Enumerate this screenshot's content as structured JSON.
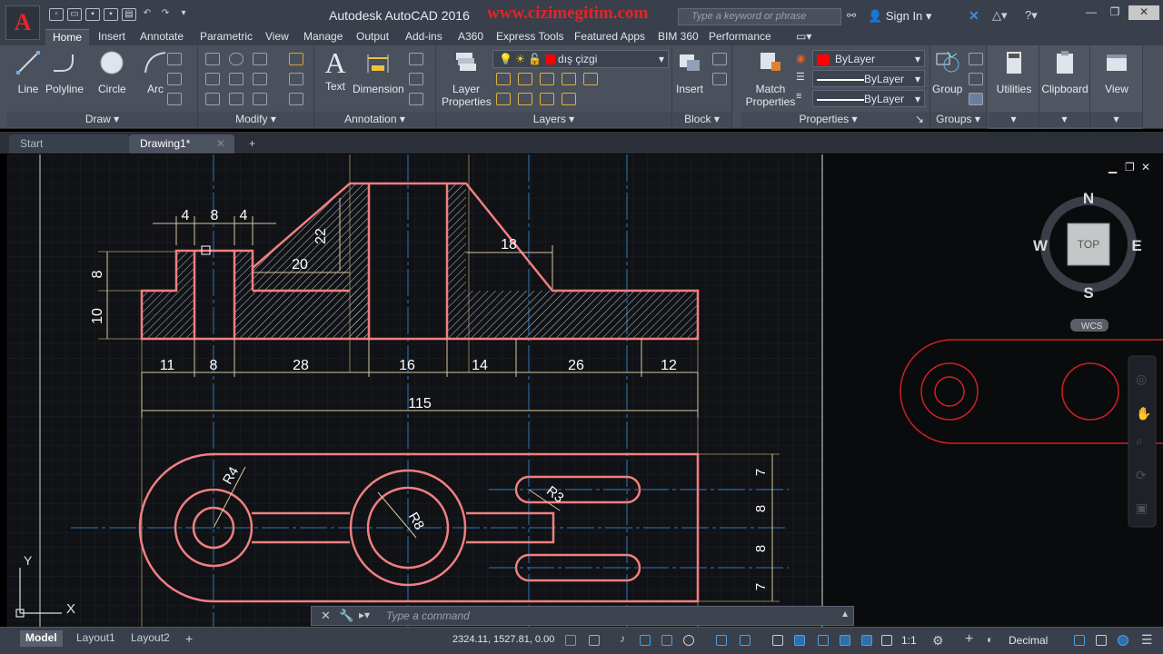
{
  "window": {
    "app_title": "Autodesk AutoCAD 2016",
    "brand_text": "www.cizimegitim.com",
    "search_placeholder": "Type a keyword or phrase",
    "sign_in": "Sign In"
  },
  "ribbon_tabs": [
    "Home",
    "Insert",
    "Annotate",
    "Parametric",
    "View",
    "Manage",
    "Output",
    "Add-ins",
    "A360",
    "Express Tools",
    "Featured Apps",
    "BIM 360",
    "Performance"
  ],
  "panels": {
    "draw": {
      "title": "Draw",
      "buttons": [
        "Line",
        "Polyline",
        "Circle",
        "Arc"
      ]
    },
    "modify": {
      "title": "Modify"
    },
    "annotation": {
      "title": "Annotation",
      "buttons": [
        "Text",
        "Dimension"
      ]
    },
    "layers": {
      "title": "Layers",
      "layer_properties": [
        "Layer",
        "Properties"
      ],
      "current_layer": "dış çizgi"
    },
    "block": {
      "title": "Block",
      "insert": "Insert"
    },
    "properties": {
      "title": "Properties",
      "match": [
        "Match",
        "Properties"
      ],
      "color": "ByLayer",
      "linetype": "ByLayer",
      "lineweight": "ByLayer"
    },
    "groups": {
      "title": "Groups",
      "group": "Group"
    },
    "utilities": {
      "title": "Utilities"
    },
    "clipboard": {
      "title": "Clipboard"
    },
    "view": {
      "title": "View"
    }
  },
  "doc_tabs": [
    "Start",
    "Drawing1*"
  ],
  "viewcube": {
    "n": "N",
    "s": "S",
    "e": "E",
    "w": "W",
    "face": "TOP",
    "wcs": "WCS"
  },
  "dims_front": {
    "top": [
      "4",
      "8",
      "4"
    ],
    "left": [
      "8",
      "10"
    ],
    "h22": "22",
    "h20": "20",
    "h18": "18",
    "bottom": [
      "11",
      "8",
      "28",
      "16",
      "14",
      "26",
      "12"
    ],
    "overall": "115"
  },
  "dims_top": {
    "r4": "R4",
    "r8": "R8",
    "r3": "R3",
    "right": [
      "7",
      "8",
      "8",
      "7"
    ]
  },
  "ucs": {
    "x": "X",
    "y": "Y"
  },
  "command": {
    "placeholder": "Type a command"
  },
  "layout_tabs": [
    "Model",
    "Layout1",
    "Layout2"
  ],
  "status": {
    "coords": "2324.11, 1527.81, 0.00",
    "scale": "1:1",
    "units": "Decimal"
  }
}
